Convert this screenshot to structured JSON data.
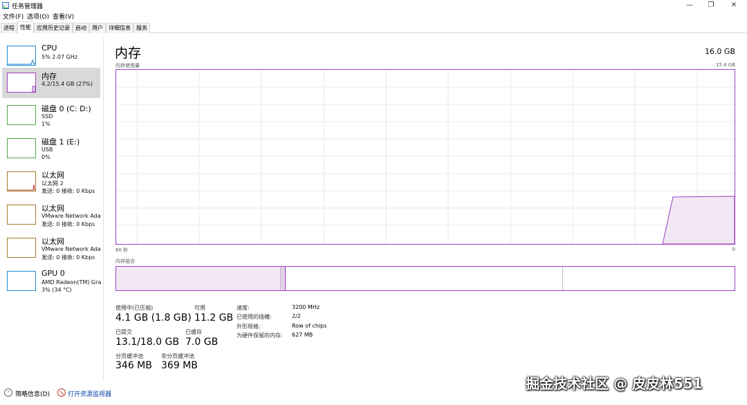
{
  "window": {
    "title": "任务管理器",
    "minimize_glyph": "—",
    "maximize_glyph": "❐",
    "close_glyph": "✕"
  },
  "menu": [
    "文件(F)",
    "选项(O)",
    "查看(V)"
  ],
  "tabs": [
    {
      "label": "进程",
      "active": false
    },
    {
      "label": "性能",
      "active": true
    },
    {
      "label": "应用历史记录",
      "active": false
    },
    {
      "label": "启动",
      "active": false
    },
    {
      "label": "用户",
      "active": false
    },
    {
      "label": "详细信息",
      "active": false
    },
    {
      "label": "服务",
      "active": false
    }
  ],
  "sidebar": {
    "items": [
      {
        "title": "CPU",
        "line1": "5% 2.07 GHz",
        "line2": "",
        "color": "#1f8ad2"
      },
      {
        "title": "内存",
        "line1": "4.2/15.4 GB (27%)",
        "line2": "",
        "color": "#9b3fbf"
      },
      {
        "title": "磁盘 0 (C: D:)",
        "line1": "SSD",
        "line2": "1%",
        "color": "#4da543"
      },
      {
        "title": "磁盘 1 (E:)",
        "line1": "USB",
        "line2": "0%",
        "color": "#4da543"
      },
      {
        "title": "以太网",
        "line1": "以太网 2",
        "line2": "发送: 0 接收: 0 Kbps",
        "color": "#a7772f"
      },
      {
        "title": "以太网",
        "line1": "VMware Network Ada",
        "line2": "发送: 0 接收: 0 Kbps",
        "color": "#a7772f"
      },
      {
        "title": "以太网",
        "line1": "VMware Network Ada",
        "line2": "发送: 0 接收: 0 Kbps",
        "color": "#a7772f"
      },
      {
        "title": "GPU 0",
        "line1": "AMD Radeon(TM) Gra",
        "line2": "3% (34 °C)",
        "color": "#1f8ad2"
      }
    ]
  },
  "main": {
    "title": "内存",
    "total": "16.0 GB",
    "usage_label": "内存使用量",
    "usage_max": "15.4 GB",
    "axis_left": "60 秒",
    "axis_right": "0",
    "composition_label": "内存组合",
    "usage_fraction_recent": 0.27,
    "accent_color": "#9b3fbf",
    "stats": {
      "in_use_label": "使用中(已压缩)",
      "in_use_value": "4.1 GB (1.8 GB)",
      "available_label": "可用",
      "available_value": "11.2 GB",
      "committed_label": "已提交",
      "committed_value": "13.1/18.0 GB",
      "cached_label": "已缓存",
      "cached_value": "7.0 GB",
      "paged_label": "分页缓冲池",
      "paged_value": "346 MB",
      "nonpaged_label": "非分页缓冲池",
      "nonpaged_value": "369 MB"
    },
    "specs": [
      {
        "label": "速度:",
        "value": "3200 MHz"
      },
      {
        "label": "已使用的插槽:",
        "value": "2/2"
      },
      {
        "label": "外形规格:",
        "value": "Row of chips"
      },
      {
        "label": "为硬件保留的内存:",
        "value": "627 MB"
      }
    ]
  },
  "footer": {
    "fewer_details": "简略信息(D)",
    "open_monitor": "打开资源监视器"
  },
  "watermark": "掘金技术社区 @ 皮皮林551"
}
